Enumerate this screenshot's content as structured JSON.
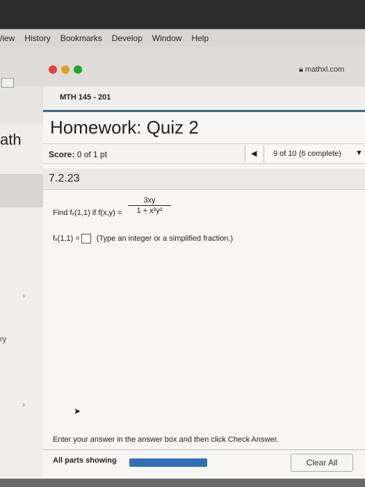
{
  "menubar": {
    "items": [
      "/iew",
      "History",
      "Bookmarks",
      "Develop",
      "Window",
      "Help"
    ]
  },
  "browser": {
    "url": "mathxl.com",
    "lock_icon": "lock-icon"
  },
  "colors": {
    "close": "#e0443e",
    "minimize": "#dea123",
    "zoom": "#1aab29",
    "accent": "#3c6b85",
    "progress": "#2f6fb6"
  },
  "left_panel": {
    "title": "ath",
    "item1": "›",
    "item2": "›",
    "label": "ry"
  },
  "header": {
    "course": "MTH 145 - 201",
    "title": "Homework: Quiz 2"
  },
  "score": {
    "label": "Score:",
    "value": "0 of 1 pt"
  },
  "nav": {
    "status": "9 of 10 (6 complete)"
  },
  "question": {
    "number": "7.2.23",
    "prompt_lead": "Find fₓ(1,1) if f(x,y) =",
    "numerator": "3xy",
    "denominator": "1 + x²y²",
    "answer_label": "fₓ(1,1) =",
    "answer_hint": "(Type an integer or a simplified fraction.)",
    "answer_value": ""
  },
  "footer": {
    "instruction": "Enter your answer in the answer box and then click Check Answer.",
    "parts_label": "All parts showing",
    "progress_fraction": 1.0,
    "clear_label": "Clear All"
  }
}
